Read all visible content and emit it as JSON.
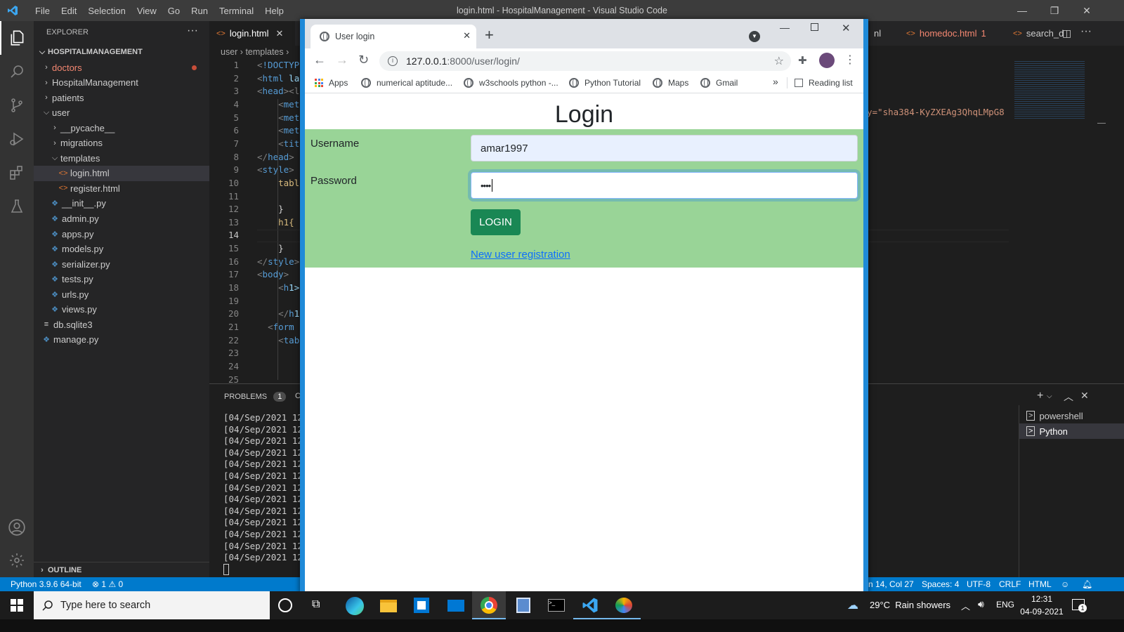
{
  "vscode": {
    "window_title": "login.html - HospitalManagement - Visual Studio Code",
    "menu": [
      "File",
      "Edit",
      "Selection",
      "View",
      "Go",
      "Run",
      "Terminal",
      "Help"
    ],
    "explorer_title": "EXPLORER",
    "explorer_more": "···",
    "project_name": "HOSPITALMANAGEMENT",
    "tree": [
      {
        "label": "doctors",
        "kind": "folder",
        "state": "closed"
      },
      {
        "label": "HospitalManagement",
        "kind": "folder",
        "state": "closed"
      },
      {
        "label": "patients",
        "kind": "folder",
        "state": "closed"
      },
      {
        "label": "user",
        "kind": "folder",
        "state": "open"
      },
      {
        "label": "__pycache__",
        "kind": "folder",
        "state": "closed"
      },
      {
        "label": "migrations",
        "kind": "folder",
        "state": "closed"
      },
      {
        "label": "templates",
        "kind": "folder",
        "state": "open"
      },
      {
        "label": "login.html",
        "kind": "html"
      },
      {
        "label": "register.html",
        "kind": "html"
      },
      {
        "label": "__init__.py",
        "kind": "py"
      },
      {
        "label": "admin.py",
        "kind": "py"
      },
      {
        "label": "apps.py",
        "kind": "py"
      },
      {
        "label": "models.py",
        "kind": "py"
      },
      {
        "label": "serializer.py",
        "kind": "py"
      },
      {
        "label": "tests.py",
        "kind": "py"
      },
      {
        "label": "urls.py",
        "kind": "py"
      },
      {
        "label": "views.py",
        "kind": "py"
      },
      {
        "label": "db.sqlite3",
        "kind": "db"
      },
      {
        "label": "manage.py",
        "kind": "py"
      }
    ],
    "outline_label": "OUTLINE",
    "tabs": {
      "active": "login.html",
      "right_partial": "nl",
      "homedoc": "homedoc.html",
      "homedoc_count": "1",
      "search": "search_d"
    },
    "breadcrumb": [
      "user",
      "templates"
    ],
    "code_lines": [
      {
        "n": "1",
        "t": "<!DOCTYP"
      },
      {
        "n": "2",
        "t": "<html la"
      },
      {
        "n": "3",
        "t": "<head><l"
      },
      {
        "n": "4",
        "t": "    <met"
      },
      {
        "n": "5",
        "t": "    <met"
      },
      {
        "n": "6",
        "t": "    <met"
      },
      {
        "n": "7",
        "t": "    <tit"
      },
      {
        "n": "8",
        "t": "</head>"
      },
      {
        "n": "9",
        "t": "<style>"
      },
      {
        "n": "10",
        "t": "    tabl"
      },
      {
        "n": "11",
        "t": ""
      },
      {
        "n": "12",
        "t": "    }"
      },
      {
        "n": "13",
        "t": "    h1{"
      },
      {
        "n": "14",
        "t": ""
      },
      {
        "n": "15",
        "t": "    }"
      },
      {
        "n": "16",
        "t": "</style>"
      },
      {
        "n": "17",
        "t": "<body>"
      },
      {
        "n": "18",
        "t": "    <h1>"
      },
      {
        "n": "19",
        "t": ""
      },
      {
        "n": "20",
        "t": "    </h1"
      },
      {
        "n": "21",
        "t": "  <form "
      },
      {
        "n": "22",
        "t": "    <tab"
      },
      {
        "n": "23",
        "t": ""
      },
      {
        "n": "24",
        "t": ""
      },
      {
        "n": "25",
        "t": ""
      }
    ],
    "code_right": "y=\"sha384-KyZXEAg3QhqLMpG8",
    "panel": {
      "problems_label": "PROBLEMS",
      "problems_count": "1",
      "partial_tab": "C",
      "terminal_lines": [
        "[04/Sep/2021 12:",
        "[04/Sep/2021 12:",
        "[04/Sep/2021 12:",
        "[04/Sep/2021 12:",
        "[04/Sep/2021 12:",
        "[04/Sep/2021 12:",
        "[04/Sep/2021 12:",
        "[04/Sep/2021 12:",
        "[04/Sep/2021 12:",
        "[04/Sep/2021 12:",
        "[04/Sep/2021 12:",
        "[04/Sep/2021 12:",
        "[04/Sep/2021 12:"
      ],
      "terminals": [
        "powershell",
        "Python"
      ]
    },
    "status": {
      "python": "Python 3.9.6 64-bit",
      "errors": "⊗ 1 ⚠ 0",
      "position": "n 14, Col 27",
      "spaces": "Spaces: 4",
      "encoding": "UTF-8",
      "eol": "CRLF",
      "language": "HTML"
    }
  },
  "chrome": {
    "tab_title": "User login",
    "url_host": "127.0.0.1",
    "url_rest": ":8000/user/login/",
    "bookmarks": [
      "Apps",
      "numerical aptitude...",
      "w3schools python -...",
      "Python Tutorial",
      "Maps",
      "Gmail"
    ],
    "reading_list": "Reading list",
    "more": "»"
  },
  "page": {
    "heading": "Login",
    "username_label": "Username",
    "username_value": "amar1997",
    "password_label": "Password",
    "password_value": "••••",
    "login_button": "LOGIN",
    "register_link": "New user registration"
  },
  "taskbar": {
    "search_placeholder": "Type here to search",
    "weather": "29°C  Rain showers",
    "lang": "ENG",
    "time": "12:31",
    "date": "04-09-2021",
    "notif_count": "1"
  },
  "colors": {
    "accent": "#007acc",
    "form_bg": "#99d497",
    "button": "#198754",
    "link": "#0d6efd"
  }
}
